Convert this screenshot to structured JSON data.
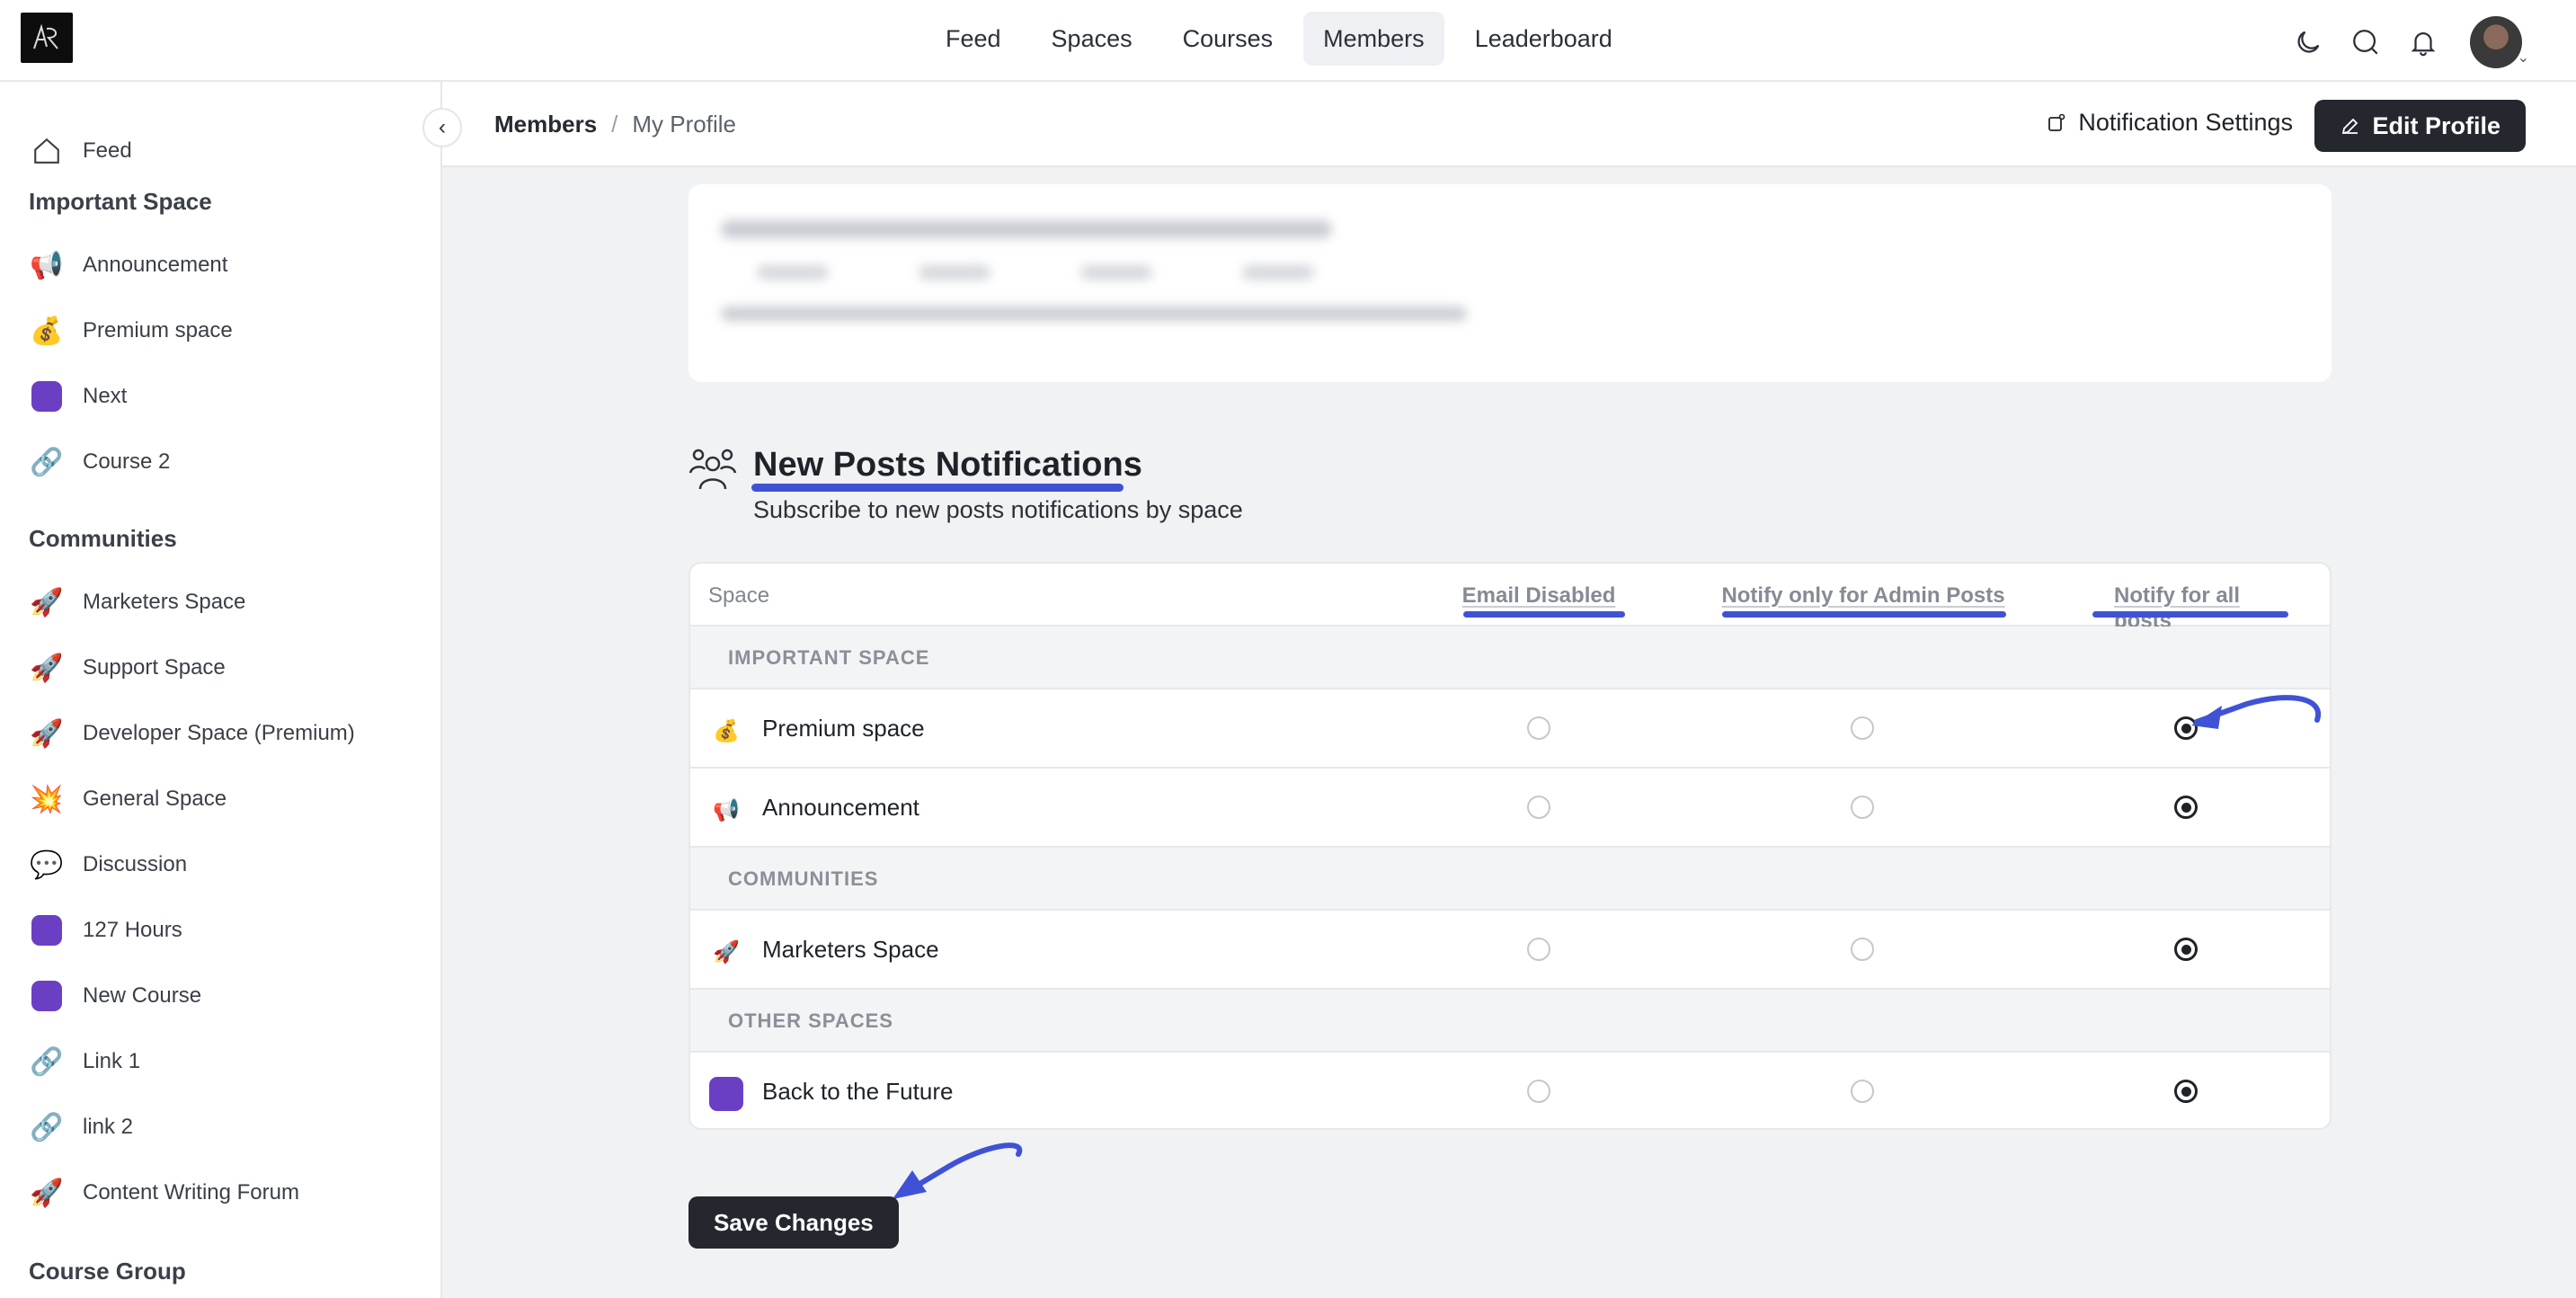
{
  "topnav": {
    "links": [
      "Feed",
      "Spaces",
      "Courses",
      "Members",
      "Leaderboard"
    ],
    "active": "Members"
  },
  "sidebar": {
    "feed": "Feed",
    "headings": [
      "Important Space",
      "Communities",
      "Course Group"
    ],
    "important": [
      {
        "label": "Announcement",
        "icon": "megaphone-icon"
      },
      {
        "label": "Premium space",
        "icon": "money-bag-icon"
      },
      {
        "label": "Next",
        "icon": "purple-square-icon"
      },
      {
        "label": "Course 2",
        "icon": "link-icon"
      }
    ],
    "communities": [
      {
        "label": "Marketers Space",
        "icon": "rocket-icon"
      },
      {
        "label": "Support Space",
        "icon": "rocket-icon"
      },
      {
        "label": "Developer Space (Premium)",
        "icon": "rocket-icon"
      },
      {
        "label": "General Space",
        "icon": "collision-icon"
      },
      {
        "label": "Discussion",
        "icon": "speech-bubble-icon"
      },
      {
        "label": "127 Hours",
        "icon": "purple-square-icon"
      },
      {
        "label": "New Course",
        "icon": "purple-square-icon"
      },
      {
        "label": "Link 1",
        "icon": "link-icon"
      },
      {
        "label": "link 2",
        "icon": "link-icon"
      },
      {
        "label": "Content Writing Forum",
        "icon": "rocket-icon"
      }
    ]
  },
  "subheader": {
    "breadcrumb_main": "Members",
    "breadcrumb_sep": "/",
    "breadcrumb_sub": "My Profile",
    "notification_settings": "Notification Settings",
    "edit_profile": "Edit Profile"
  },
  "section": {
    "title": "New Posts Notifications",
    "subtitle": "Subscribe to new posts notifications by space"
  },
  "table": {
    "space_header": "Space",
    "columns": [
      "Email Disabled",
      "Notify only for Admin Posts",
      "Notify for all posts"
    ],
    "groups": [
      {
        "label": "IMPORTANT SPACE",
        "rows": [
          {
            "name": "Premium space",
            "icon": "money-bag-icon",
            "selected": 2
          },
          {
            "name": "Announcement",
            "icon": "megaphone-icon",
            "selected": 2
          }
        ]
      },
      {
        "label": "COMMUNITIES",
        "rows": [
          {
            "name": "Marketers Space",
            "icon": "rocket-icon",
            "selected": 2
          }
        ]
      },
      {
        "label": "OTHER SPACES",
        "rows": [
          {
            "name": "Back to the Future",
            "icon": "purple-square-icon",
            "selected": 2
          }
        ]
      }
    ]
  },
  "save_button": "Save Changes",
  "colors": {
    "accent": "#3f52d6",
    "dark_button": "#24272d",
    "space_purple": "#6b3fc4"
  }
}
